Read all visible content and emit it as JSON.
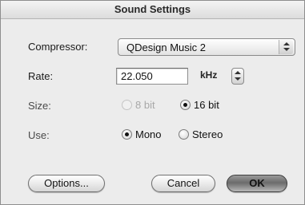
{
  "window": {
    "title": "Sound Settings"
  },
  "compressor": {
    "label": "Compressor:",
    "value": "QDesign Music 2"
  },
  "rate": {
    "label": "Rate:",
    "value": "22.050",
    "unit": "kHz"
  },
  "size": {
    "label": "Size:",
    "option_8": "8 bit",
    "option_16": "16 bit",
    "selected": "16 bit"
  },
  "use": {
    "label": "Use:",
    "option_mono": "Mono",
    "option_stereo": "Stereo",
    "selected": "Mono"
  },
  "buttons": {
    "options": "Options...",
    "cancel": "Cancel",
    "ok": "OK"
  }
}
